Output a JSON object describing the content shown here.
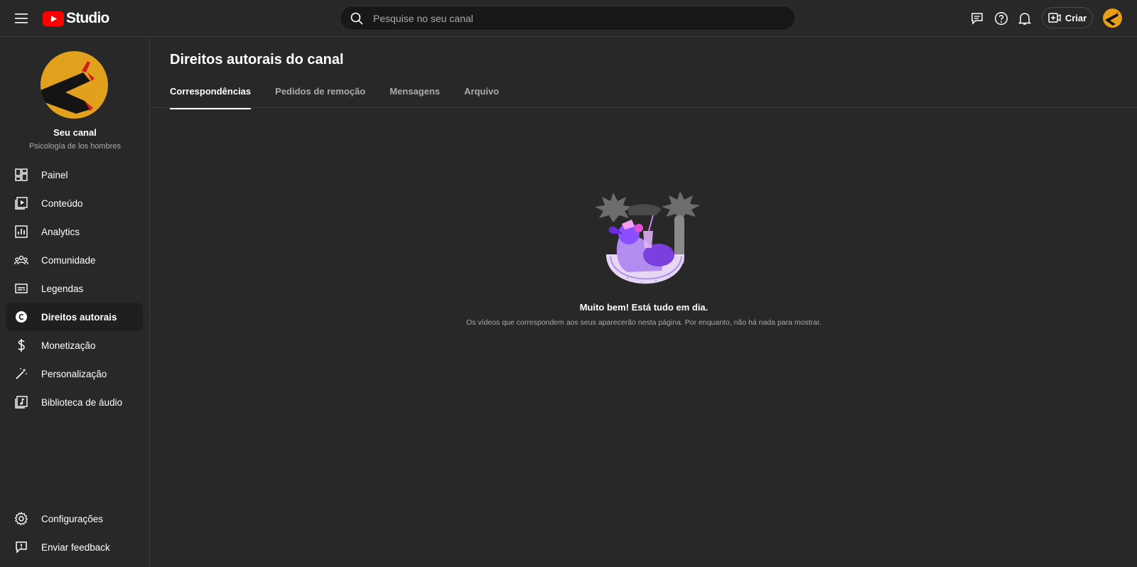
{
  "app": {
    "logo_text": "Studio"
  },
  "search": {
    "placeholder": "Pesquise no seu canal"
  },
  "header": {
    "create_label": "Criar"
  },
  "channel": {
    "name": "Seu canal",
    "subtitle": "Psicología de los hombres"
  },
  "sidebar": {
    "items": [
      {
        "label": "Painel",
        "icon": "dashboard-icon"
      },
      {
        "label": "Conteúdo",
        "icon": "content-icon"
      },
      {
        "label": "Analytics",
        "icon": "analytics-icon"
      },
      {
        "label": "Comunidade",
        "icon": "community-icon"
      },
      {
        "label": "Legendas",
        "icon": "subtitles-icon"
      },
      {
        "label": "Direitos autorais",
        "icon": "copyright-icon",
        "active": true
      },
      {
        "label": "Monetização",
        "icon": "dollar-icon"
      },
      {
        "label": "Personalização",
        "icon": "magic-wand-icon"
      },
      {
        "label": "Biblioteca de áudio",
        "icon": "audio-library-icon"
      }
    ],
    "bottom_items": [
      {
        "label": "Configurações",
        "icon": "gear-icon"
      },
      {
        "label": "Enviar feedback",
        "icon": "feedback-icon"
      }
    ]
  },
  "main": {
    "title": "Direitos autorais do canal",
    "tabs": [
      {
        "label": "Correspondências",
        "active": true
      },
      {
        "label": "Pedidos de remoção"
      },
      {
        "label": "Mensagens"
      },
      {
        "label": "Arquivo"
      }
    ],
    "empty_state": {
      "title": "Muito bem! Está tudo em dia.",
      "description": "Os vídeos que correspondem aos seus aparecerão nesta página. Por enquanto, não há nada para mostrar."
    }
  },
  "colors": {
    "background": "#282828",
    "brand_red": "#ff0000",
    "avatar_yellow": "#e1a11d",
    "accent_purple": "#8a4fff"
  }
}
